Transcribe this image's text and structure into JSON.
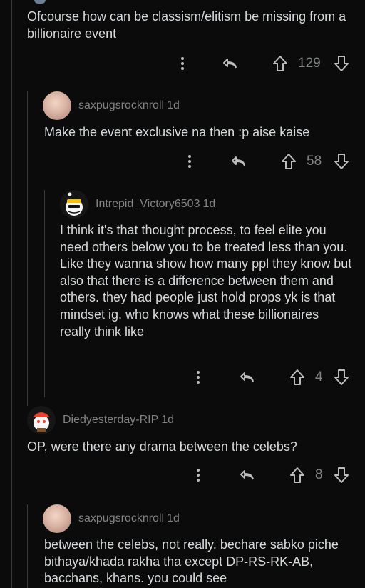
{
  "comments": [
    {
      "text": "Ofcourse how can be classism/elitism be missing from a billionaire event",
      "votes": "129"
    },
    {
      "username": "saxpugsrocknroll",
      "age": "1d",
      "text": "Make the event exclusive na then :p aise kaise",
      "votes": "58"
    },
    {
      "username": "Intrepid_Victory6503",
      "age": "1d",
      "text": "I think it's that thought process, to feel elite you need others below you to be treated less than you. Like they wanna show how many ppl they know but also that there is a difference between them and others. they had people just hold props yk is that mindset ig. who knows what these billionaires really think like",
      "votes": "4"
    },
    {
      "username": "Diedyesterday-RIP",
      "age": "1d",
      "text": "OP, were there any drama between the celebs?",
      "votes": "8"
    },
    {
      "username": "saxpugsrocknroll",
      "age": "1d",
      "text": "between the celebs, not really. bechare sabko piche bithaya/khada rakha tha except DP-RS-RK-AB, bacchans, khans. you could see"
    }
  ],
  "icons": {
    "more": "more-options-icon",
    "reply": "reply-icon",
    "upvote": "upvote-icon",
    "downvote": "downvote-icon"
  },
  "colors": {
    "background": "#0b0b0b",
    "text": "#d7dadc",
    "muted": "#818384",
    "thread_line": "#3a3a3a"
  }
}
